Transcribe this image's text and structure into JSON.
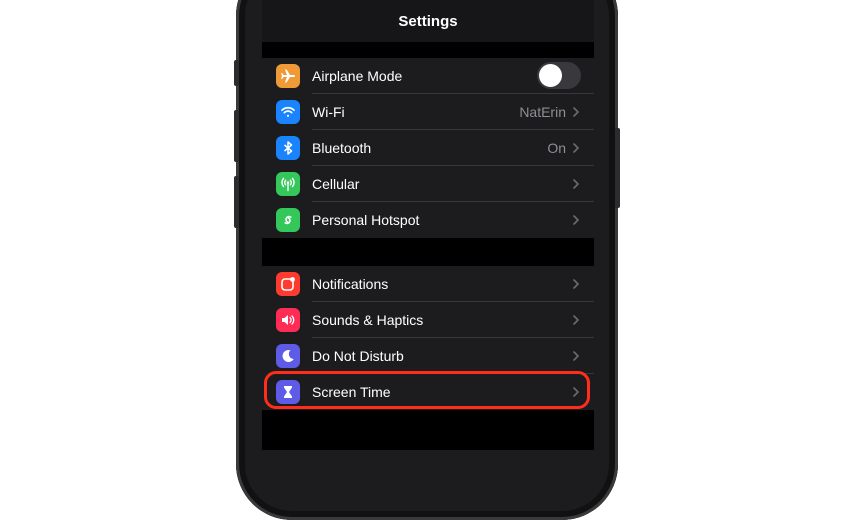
{
  "header": {
    "title": "Settings"
  },
  "groups": [
    {
      "items": [
        {
          "label": "Airplane Mode",
          "value": "",
          "icon": "airplane-icon",
          "icon_bg": "#f09a37",
          "control": "toggle",
          "toggle_on": false
        },
        {
          "label": "Wi-Fi",
          "value": "NatErin",
          "icon": "wifi-icon",
          "icon_bg": "#1a84ff",
          "control": "chevron"
        },
        {
          "label": "Bluetooth",
          "value": "On",
          "icon": "bluetooth-icon",
          "icon_bg": "#1a84ff",
          "control": "chevron"
        },
        {
          "label": "Cellular",
          "value": "",
          "icon": "antenna-icon",
          "icon_bg": "#34c759",
          "control": "chevron"
        },
        {
          "label": "Personal Hotspot",
          "value": "",
          "icon": "hotspot-icon",
          "icon_bg": "#34c759",
          "control": "chevron"
        }
      ]
    },
    {
      "items": [
        {
          "label": "Notifications",
          "value": "",
          "icon": "notifications-icon",
          "icon_bg": "#ff3b30",
          "control": "chevron"
        },
        {
          "label": "Sounds & Haptics",
          "value": "",
          "icon": "speaker-icon",
          "icon_bg": "#ff2d55",
          "control": "chevron"
        },
        {
          "label": "Do Not Disturb",
          "value": "",
          "icon": "moon-icon",
          "icon_bg": "#5e5ce6",
          "control": "chevron"
        },
        {
          "label": "Screen Time",
          "value": "",
          "icon": "hourglass-icon",
          "icon_bg": "#5e5ce6",
          "control": "chevron"
        }
      ]
    }
  ],
  "highlight_color": "#ff2d1a"
}
